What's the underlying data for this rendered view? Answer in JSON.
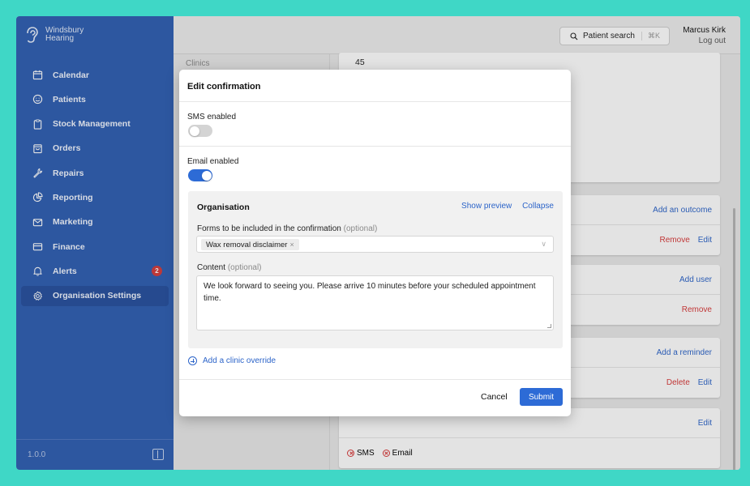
{
  "brand": {
    "line1": "Windsbury",
    "line2": "Hearing"
  },
  "sidebar": {
    "items": [
      {
        "label": "Calendar",
        "icon": "calendar-icon"
      },
      {
        "label": "Patients",
        "icon": "smile-icon"
      },
      {
        "label": "Stock Management",
        "icon": "clipboard-icon"
      },
      {
        "label": "Orders",
        "icon": "bag-icon"
      },
      {
        "label": "Repairs",
        "icon": "wrench-icon"
      },
      {
        "label": "Reporting",
        "icon": "pie-chart-icon"
      },
      {
        "label": "Marketing",
        "icon": "mail-icon"
      },
      {
        "label": "Finance",
        "icon": "credit-card-icon"
      },
      {
        "label": "Alerts",
        "icon": "bell-icon",
        "badge": "2"
      },
      {
        "label": "Organisation Settings",
        "icon": "cog-icon",
        "active": true
      }
    ],
    "version": "1.0.0"
  },
  "header": {
    "search_label": "Patient search",
    "search_shortcut": "⌘K",
    "user_name": "Marcus Kirk",
    "logout": "Log out"
  },
  "background": {
    "left_label": "Clinics",
    "value": "45",
    "actions": {
      "add_outcome": "Add an outcome",
      "remove": "Remove",
      "edit": "Edit",
      "add_user": "Add user",
      "add_reminder": "Add a reminder",
      "delete": "Delete",
      "sms": "SMS",
      "email": "Email"
    }
  },
  "modal": {
    "title": "Edit confirmation",
    "sms_label": "SMS enabled",
    "sms_enabled": false,
    "email_label": "Email enabled",
    "email_enabled": true,
    "org": {
      "title": "Organisation",
      "show_preview": "Show preview",
      "collapse": "Collapse",
      "forms_label": "Forms to be included in the confirmation",
      "forms_optional": "(optional)",
      "selected_form": "Wax removal disclaimer",
      "content_label": "Content",
      "content_optional": "(optional)",
      "content_value": "We look forward to seeing you. Please arrive 10 minutes before your scheduled appointment time."
    },
    "add_override": "Add a clinic override",
    "cancel": "Cancel",
    "submit": "Submit"
  },
  "colors": {
    "sidebar": "#2f5fb3",
    "accent": "#2d6bd6",
    "danger": "#d83a3a",
    "frame": "#3fd7c6"
  }
}
